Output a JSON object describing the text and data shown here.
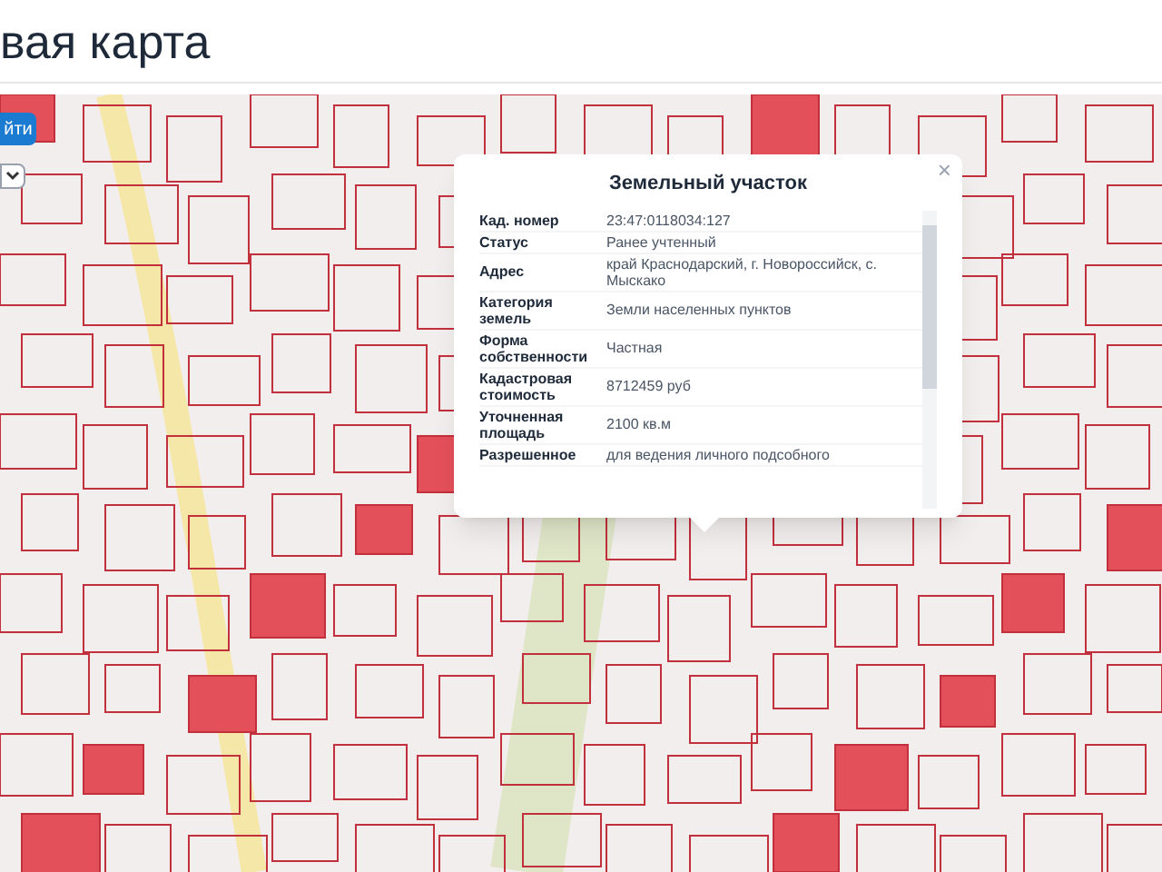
{
  "header": {
    "title": "вая карта"
  },
  "map": {
    "search_button": "йти"
  },
  "popup": {
    "title": "Земельный участок",
    "close": "×",
    "rows": [
      {
        "label": "Кад. номер",
        "value": "23:47:0118034:127"
      },
      {
        "label": "Статус",
        "value": "Ранее учтенный"
      },
      {
        "label": "Адрес",
        "value": "край Краснодарский, г. Новороссийск, с. Мыскако"
      },
      {
        "label": "Категория земель",
        "value": "Земли населенных пунктов"
      },
      {
        "label": "Форма собственности",
        "value": "Частная"
      },
      {
        "label": "Кадастровая стоимость",
        "value": "8712459 руб"
      },
      {
        "label": "Уточненная площадь",
        "value": "2100 кв.м"
      },
      {
        "label": "Разрешенное",
        "value": "для ведения личного подсобного"
      }
    ]
  }
}
